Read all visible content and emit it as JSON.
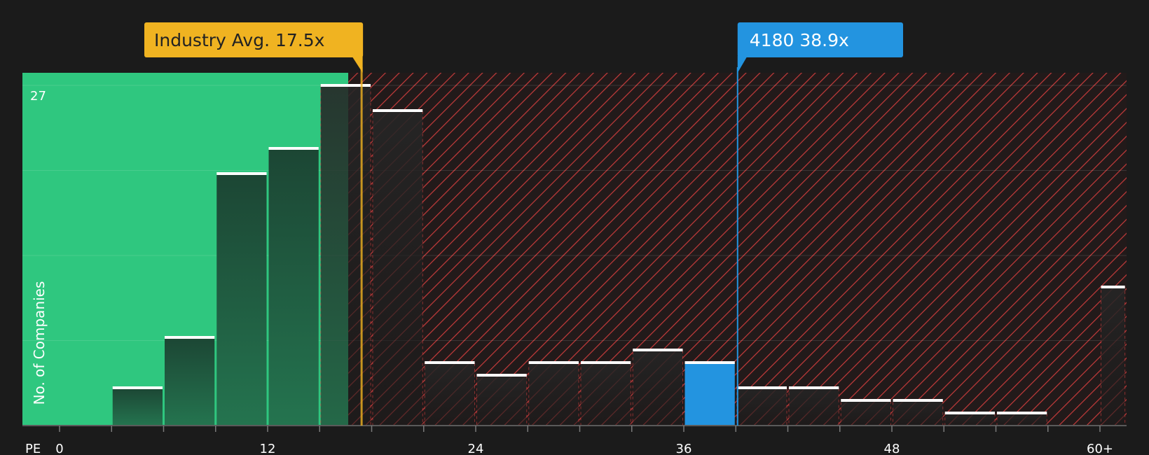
{
  "chart_data": {
    "type": "bar",
    "xlabel": "PE",
    "ylabel": "No. of Companies",
    "x_tick_labels": [
      "0",
      "12",
      "24",
      "36",
      "48",
      "60+"
    ],
    "x_ticks": [
      0,
      12,
      24,
      36,
      48,
      60
    ],
    "y_top_label": "27",
    "ylim": [
      0,
      27
    ],
    "bin_width": 3,
    "bins": [
      {
        "x0": 3,
        "x1": 6,
        "value": 3
      },
      {
        "x0": 6,
        "x1": 9,
        "value": 7
      },
      {
        "x0": 9,
        "x1": 12,
        "value": 20
      },
      {
        "x0": 12,
        "x1": 15,
        "value": 22
      },
      {
        "x0": 15,
        "x1": 18,
        "value": 27
      },
      {
        "x0": 18,
        "x1": 21,
        "value": 25
      },
      {
        "x0": 21,
        "x1": 24,
        "value": 5
      },
      {
        "x0": 24,
        "x1": 27,
        "value": 4
      },
      {
        "x0": 27,
        "x1": 30,
        "value": 5
      },
      {
        "x0": 30,
        "x1": 33,
        "value": 5
      },
      {
        "x0": 33,
        "x1": 36,
        "value": 6
      },
      {
        "x0": 36,
        "x1": 39,
        "value": 5,
        "highlight": true
      },
      {
        "x0": 39,
        "x1": 42,
        "value": 3
      },
      {
        "x0": 42,
        "x1": 45,
        "value": 3
      },
      {
        "x0": 45,
        "x1": 48,
        "value": 2
      },
      {
        "x0": 48,
        "x1": 51,
        "value": 2
      },
      {
        "x0": 51,
        "x1": 54,
        "value": 1
      },
      {
        "x0": 54,
        "x1": 57,
        "value": 1
      },
      {
        "x0": 60,
        "x1": 61.5,
        "value": 11
      }
    ],
    "industry_avg": {
      "label": "Industry Avg. 17.5x",
      "value": 17.5,
      "color": "#f0b321"
    },
    "company": {
      "label": "4180 38.9x",
      "value": 38.9,
      "color": "#2394e0"
    },
    "colors": {
      "background": "#1b1b1b",
      "undervalued_zone": "#2fc77f",
      "overvalued_hatch": "#e24141",
      "bar_dark": "#1e3f32",
      "bar_highlight": "#2394e0"
    }
  }
}
